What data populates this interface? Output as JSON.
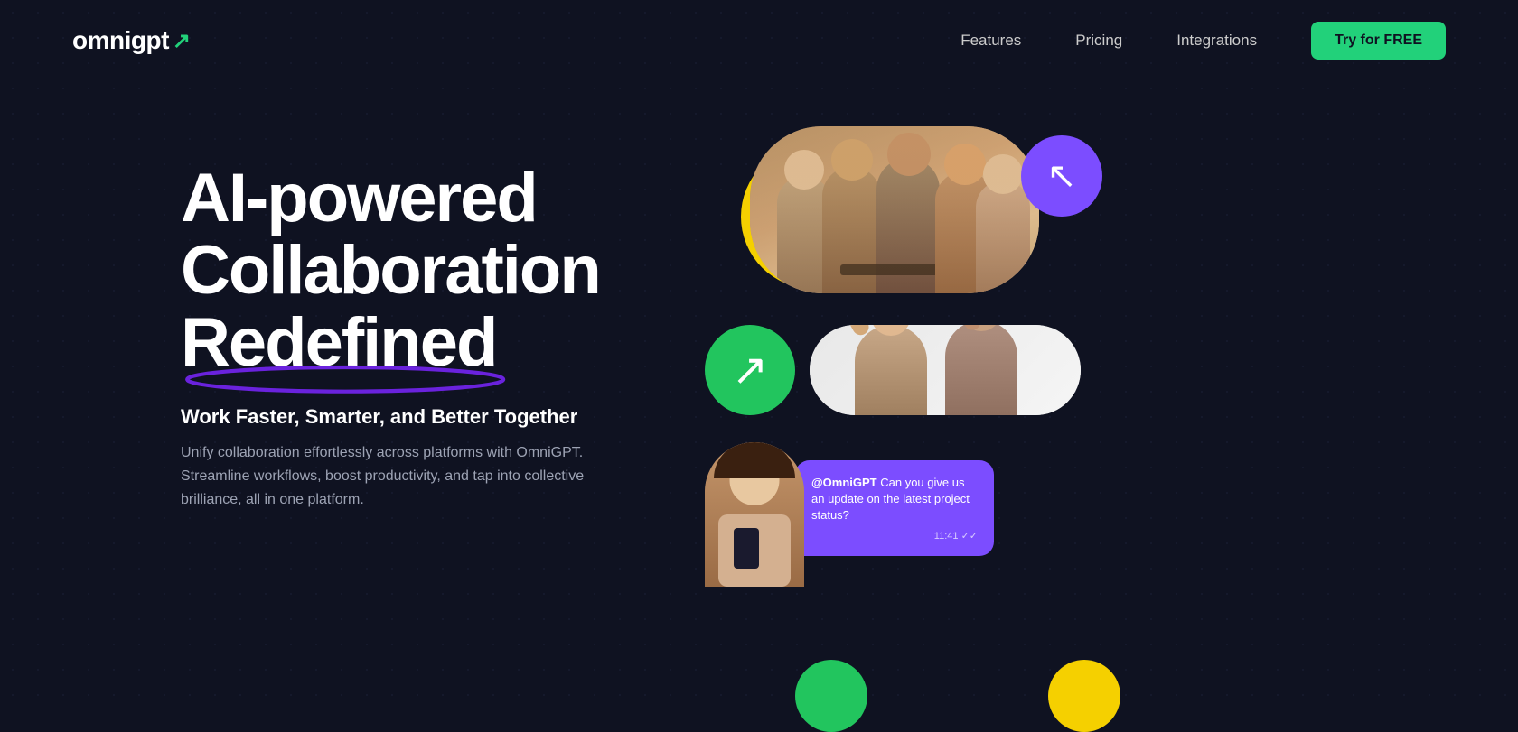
{
  "logo": {
    "text": "omnigpt",
    "arrow": "↗"
  },
  "nav": {
    "links": [
      {
        "label": "Features",
        "id": "features"
      },
      {
        "label": "Pricing",
        "id": "pricing"
      },
      {
        "label": "Integrations",
        "id": "integrations"
      }
    ],
    "cta": "Try for FREE"
  },
  "hero": {
    "headline_line1": "AI-powered",
    "headline_line2": "Collaboration",
    "headline_line3": "Redefined",
    "subheading": "Work Faster, Smarter, and Better Together",
    "body": "Unify collaboration effortlessly across platforms with OmniGPT. Streamline workflows, boost productivity, and tap into collective brilliance, all in one platform."
  },
  "chat": {
    "mention": "@OmniGPT",
    "message": " Can you give us an update on the latest project status?",
    "time": "11:41 ✓✓"
  },
  "colors": {
    "bg": "#0f1221",
    "green": "#22d17a",
    "purple": "#7c4dff",
    "yellow": "#f5d000"
  }
}
